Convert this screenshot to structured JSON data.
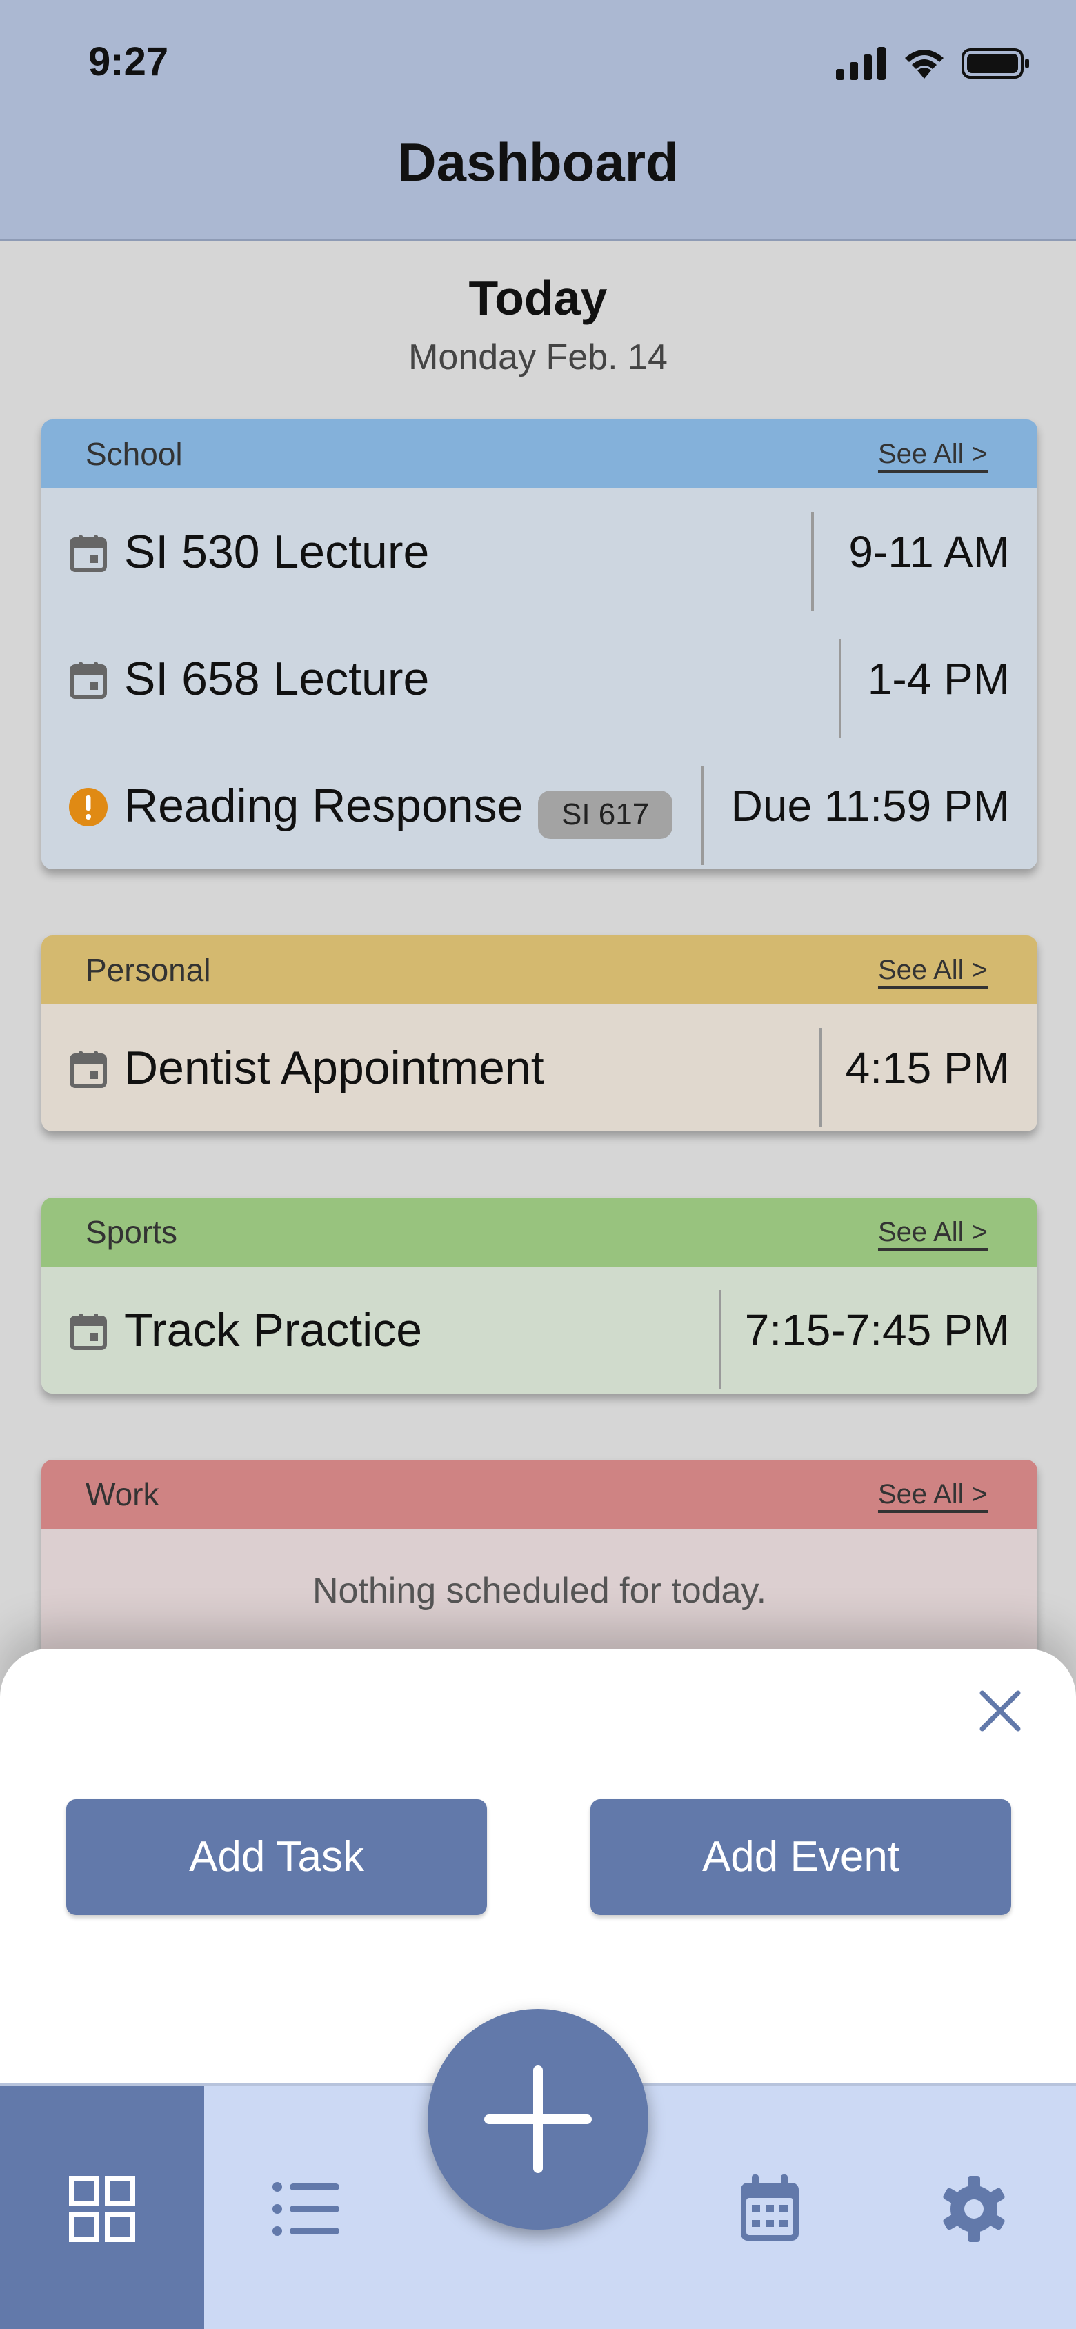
{
  "status_bar": {
    "time": "9:27"
  },
  "header": {
    "title": "Dashboard"
  },
  "today": {
    "title": "Today",
    "date": "Monday Feb. 14"
  },
  "categories": [
    {
      "name": "School",
      "see_all": "See All >",
      "colors": {
        "header": "#84b1da",
        "body": "#cdd6e0"
      },
      "items": [
        {
          "icon": "calendar-event-icon",
          "title": "SI 530 Lecture",
          "time": "9-11 AM"
        },
        {
          "icon": "calendar-event-icon",
          "title": "SI 658 Lecture",
          "time": "1-4 PM"
        },
        {
          "icon": "alert-icon",
          "title": "Reading Response",
          "tag": "SI 617",
          "time": "Due 11:59 PM"
        }
      ]
    },
    {
      "name": "Personal",
      "see_all": "See All >",
      "colors": {
        "header": "#d4b96f",
        "body": "#e0d8ce"
      },
      "items": [
        {
          "icon": "calendar-event-icon",
          "title": "Dentist Appointment",
          "time": "4:15 PM"
        }
      ]
    },
    {
      "name": "Sports",
      "see_all": "See All >",
      "colors": {
        "header": "#98c37e",
        "body": "#d0dbcc"
      },
      "items": [
        {
          "icon": "calendar-event-icon",
          "title": "Track Practice",
          "time": "7:15-7:45 PM"
        }
      ]
    },
    {
      "name": "Work",
      "see_all": "See All >",
      "colors": {
        "header": "#cf8383",
        "body": "#dccfd0"
      },
      "empty_message": "Nothing scheduled for today."
    }
  ],
  "sheet": {
    "add_task_label": "Add Task",
    "add_event_label": "Add Event"
  },
  "tabbar": {
    "tabs": [
      {
        "icon": "dashboard-grid-icon",
        "active": true
      },
      {
        "icon": "list-icon",
        "active": false
      },
      {
        "icon": "calendar-icon",
        "active": false
      },
      {
        "icon": "gear-icon",
        "active": false
      }
    ],
    "fab_icon": "plus-icon"
  },
  "colors": {
    "accent": "#6279aa",
    "alert": "#e08a14",
    "tabbar_bg": "#ccd9f4",
    "header_bg": "#abb8d2"
  }
}
